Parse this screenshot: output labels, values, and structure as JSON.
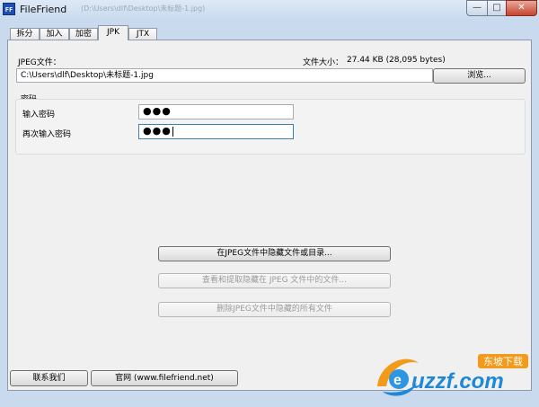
{
  "window": {
    "title": "FileFriend",
    "icon_text": "FF",
    "background_title": "(D:\\Users\\dlf\\Desktop\\未标题-1.jpg)",
    "controls": {
      "minimize": "—",
      "maximize": "□",
      "close": "✕"
    }
  },
  "tabs": [
    {
      "label": "拆分"
    },
    {
      "label": "加入"
    },
    {
      "label": "加密"
    },
    {
      "label": "JPK",
      "active": true
    },
    {
      "label": "JTX"
    }
  ],
  "jpk": {
    "file_label": "JPEG文件：",
    "size_label": "文件大小：",
    "size_value": "27.44 KB (28,095 bytes)",
    "file_path": "C:\\Users\\dlf\\Desktop\\未标题-1.jpg",
    "browse_button": "浏览...",
    "password_group": {
      "title": "密码",
      "enter_label": "输入密码",
      "enter_value": "●●●",
      "reenter_label": "再次输入密码",
      "reenter_value": "●●●"
    },
    "actions": {
      "hide": "在JPEG文件中隐藏文件或目录...",
      "extract": "查看和提取隐藏在 JPEG 文件中的文件...",
      "delete": "删除JPEG文件中隐藏的所有文件"
    }
  },
  "footer": {
    "contact_button": "联系我们",
    "website_button": "官网 (www.filefriend.net)"
  },
  "watermark": {
    "text": "uzzf.com",
    "tag": "东坡下载"
  }
}
